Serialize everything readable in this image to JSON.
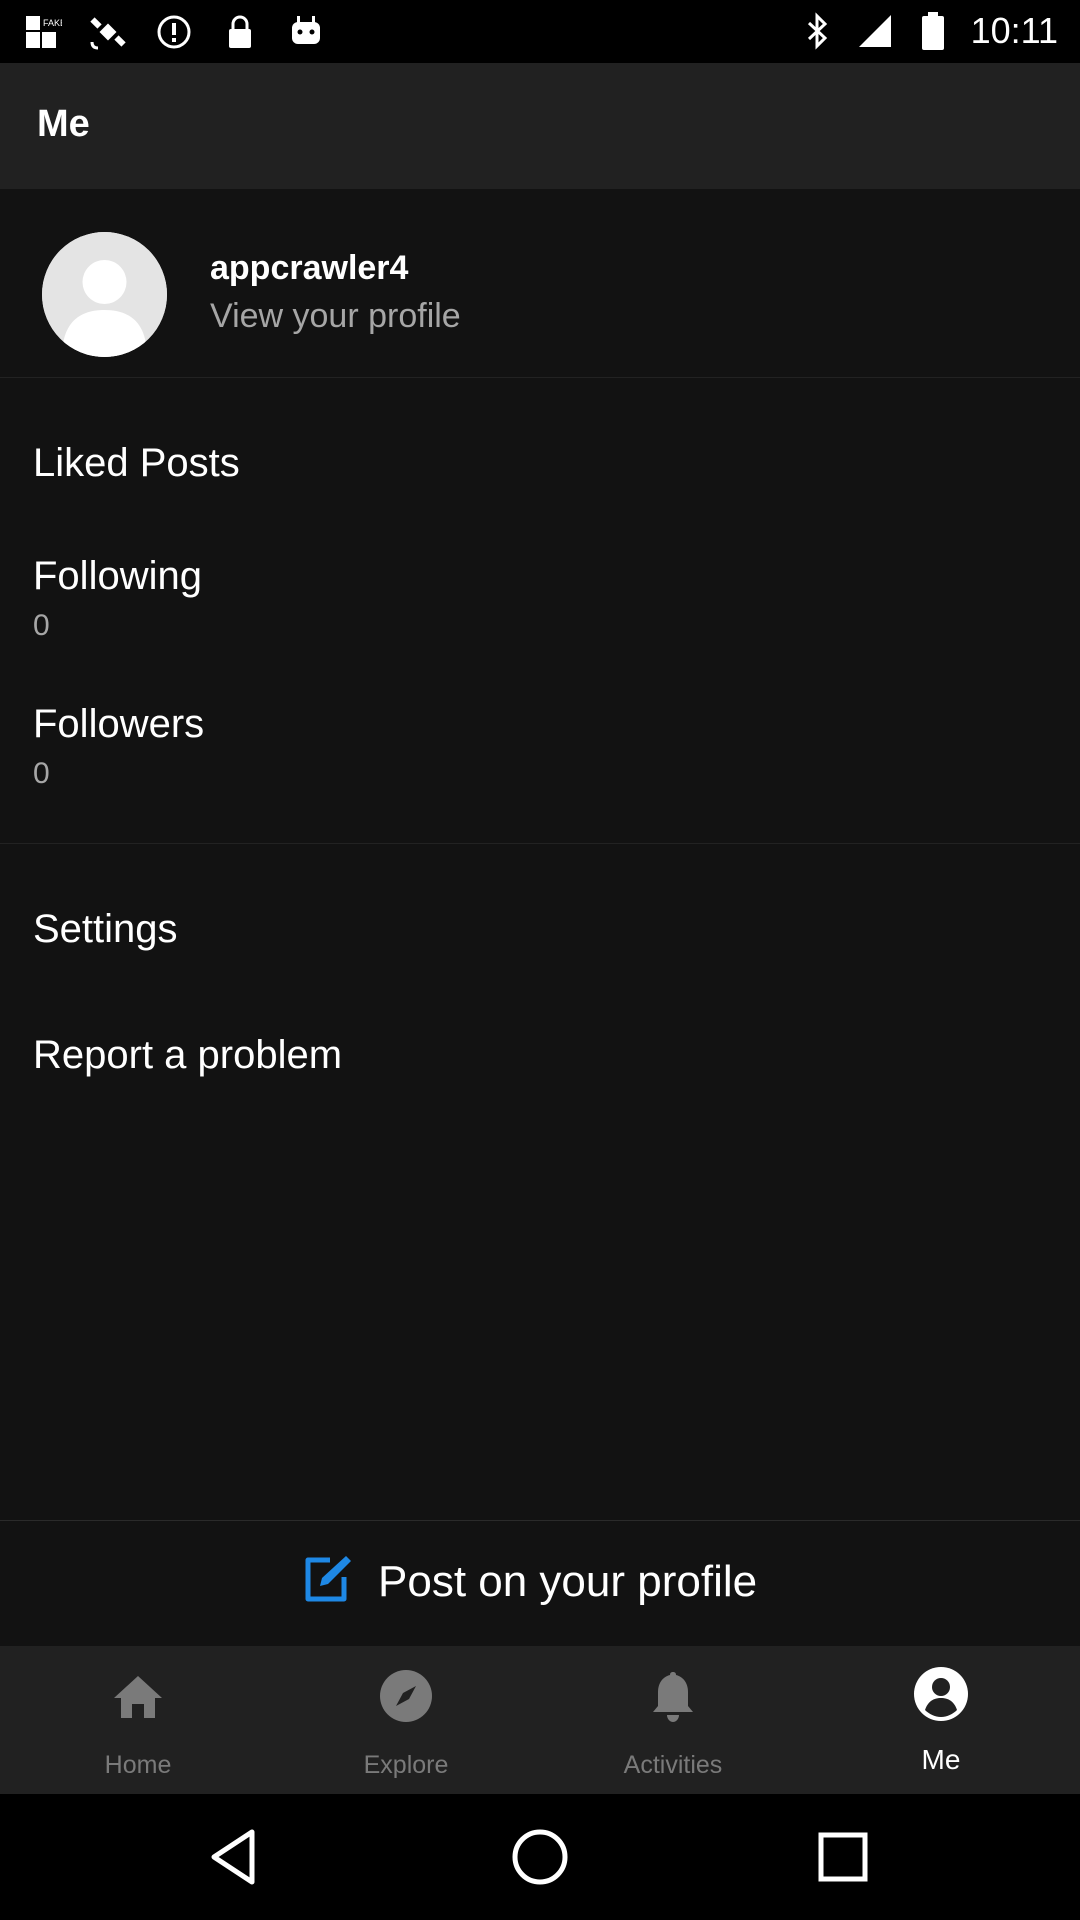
{
  "status_bar": {
    "time": "10:11",
    "left_icons": [
      "fake-gps-icon",
      "satellite-icon",
      "info-circle-icon",
      "lock-icon",
      "android-icon"
    ],
    "right_icons": [
      "bluetooth-icon",
      "signal-icon",
      "battery-icon"
    ]
  },
  "appbar": {
    "title": "Me"
  },
  "profile": {
    "username": "appcrawler4",
    "subtitle": "View your profile"
  },
  "menu": {
    "liked_posts": "Liked Posts",
    "following_label": "Following",
    "following_count": "0",
    "followers_label": "Followers",
    "followers_count": "0",
    "settings": "Settings",
    "report": "Report a problem"
  },
  "post_bar": {
    "label": "Post on your profile",
    "icon": "edit-icon",
    "accent": "#1e88e5"
  },
  "bottom_nav": {
    "items": [
      {
        "label": "Home",
        "icon": "home-icon"
      },
      {
        "label": "Explore",
        "icon": "compass-icon"
      },
      {
        "label": "Activities",
        "icon": "bell-icon"
      },
      {
        "label": "Me",
        "icon": "user-circle-icon"
      }
    ],
    "active": "Me"
  },
  "system_nav": [
    "back-icon",
    "home-circle-icon",
    "recents-icon"
  ]
}
